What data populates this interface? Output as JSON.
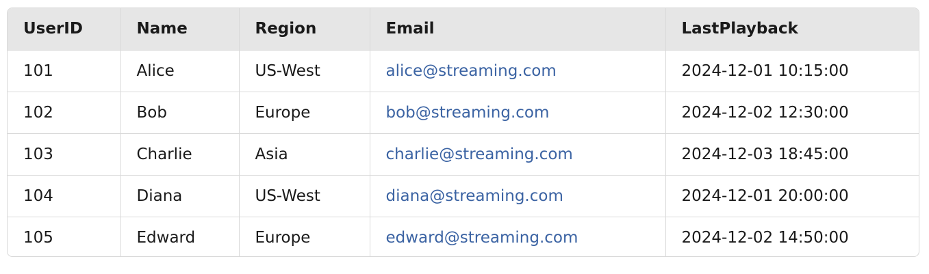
{
  "table": {
    "columns": [
      "UserID",
      "Name",
      "Region",
      "Email",
      "LastPlayback"
    ],
    "rows": [
      [
        "101",
        "Alice",
        "US-West",
        "alice@streaming.com",
        "2024-12-01 10:15:00"
      ],
      [
        "102",
        "Bob",
        "Europe",
        "bob@streaming.com",
        "2024-12-02 12:30:00"
      ],
      [
        "103",
        "Charlie",
        "Asia",
        "charlie@streaming.com",
        "2024-12-03 18:45:00"
      ],
      [
        "104",
        "Diana",
        "US-West",
        "diana@streaming.com",
        "2024-12-01 20:00:00"
      ],
      [
        "105",
        "Edward",
        "Europe",
        "edward@streaming.com",
        "2024-12-02 14:50:00"
      ]
    ]
  },
  "colors": {
    "header_bg": "#e6e6e6",
    "border": "#d9d9d9",
    "text": "#1a1a1a",
    "email_link": "#3b63a3"
  }
}
